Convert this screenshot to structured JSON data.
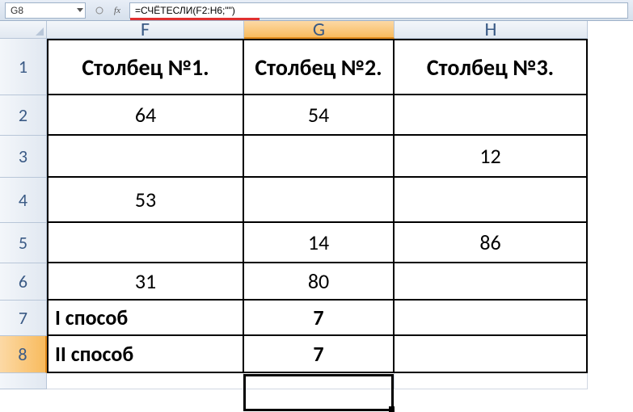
{
  "namebox": {
    "value": "G8"
  },
  "formula_bar": {
    "text": "=СЧЁТЕСЛИ(F2:H6;\"\")"
  },
  "columns": {
    "F": "F",
    "G": "G",
    "H": "H"
  },
  "row_labels": [
    "1",
    "2",
    "3",
    "4",
    "5",
    "6",
    "7",
    "8"
  ],
  "cells": {
    "r1": {
      "F": "Столбец №1.",
      "G": "Столбец №2.",
      "H": "Столбец №3."
    },
    "r2": {
      "F": "64",
      "G": "54",
      "H": ""
    },
    "r3": {
      "F": "",
      "G": "",
      "H": "12"
    },
    "r4": {
      "F": "53",
      "G": "",
      "H": ""
    },
    "r5": {
      "F": "",
      "G": "14",
      "H": "86"
    },
    "r6": {
      "F": "31",
      "G": "80",
      "H": ""
    },
    "r7": {
      "F": "I способ",
      "G": "7",
      "H": ""
    },
    "r8": {
      "F": "II способ",
      "G": "7",
      "H": ""
    }
  },
  "active_cell": "G8",
  "icons": {
    "fx": "fx"
  }
}
